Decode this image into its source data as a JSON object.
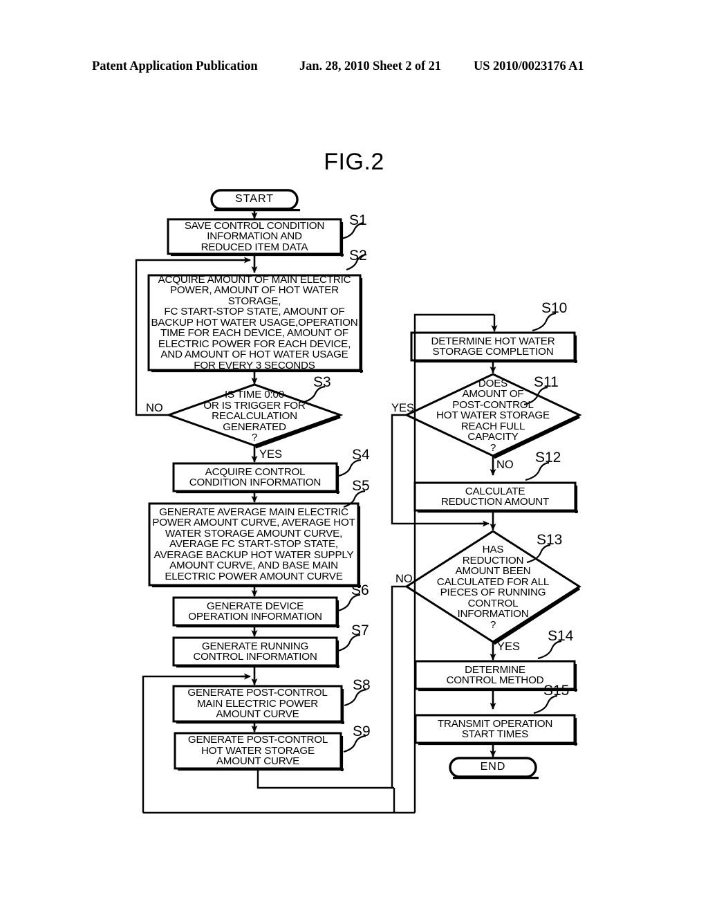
{
  "header": {
    "left": "Patent Application Publication",
    "middle": "Jan. 28, 2010  Sheet 2 of 21",
    "right": "US 2010/0023176 A1"
  },
  "figure": {
    "title": "FIG.2"
  },
  "flowchart": {
    "nodes": [
      {
        "id": "start",
        "shape": "terminator",
        "text": "START"
      },
      {
        "id": "s1",
        "shape": "process",
        "text": "SAVE CONTROL CONDITION\nINFORMATION AND\nREDUCED ITEM DATA"
      },
      {
        "id": "s2",
        "shape": "process",
        "text": "ACQUIRE AMOUNT OF MAIN ELECTRIC\nPOWER, AMOUNT OF HOT WATER STORAGE,\nFC START-STOP STATE, AMOUNT OF\nBACKUP HOT WATER USAGE,OPERATION\nTIME FOR EACH DEVICE, AMOUNT OF\nELECTRIC POWER FOR EACH DEVICE,\nAND AMOUNT OF HOT WATER USAGE\nFOR EVERY 3 SECONDS"
      },
      {
        "id": "s3",
        "shape": "decision",
        "text": "IS TIME 0:00\nOR IS TRIGGER FOR\nRECALCULATION\nGENERATED\n?"
      },
      {
        "id": "s4",
        "shape": "process",
        "text": "ACQUIRE CONTROL\nCONDITION INFORMATION"
      },
      {
        "id": "s5",
        "shape": "process",
        "text": "GENERATE AVERAGE MAIN ELECTRIC\nPOWER AMOUNT CURVE, AVERAGE HOT\nWATER STORAGE AMOUNT CURVE,\nAVERAGE FC START-STOP STATE,\nAVERAGE BACKUP HOT WATER SUPPLY\nAMOUNT CURVE, AND BASE MAIN\nELECTRIC POWER AMOUNT CURVE"
      },
      {
        "id": "s6",
        "shape": "process",
        "text": "GENERATE DEVICE\nOPERATION INFORMATION"
      },
      {
        "id": "s7",
        "shape": "process",
        "text": "GENERATE RUNNING\nCONTROL INFORMATION"
      },
      {
        "id": "s8",
        "shape": "process",
        "text": "GENERATE POST-CONTROL\nMAIN ELECTRIC POWER\nAMOUNT CURVE"
      },
      {
        "id": "s9",
        "shape": "process",
        "text": "GENERATE POST-CONTROL\nHOT WATER STORAGE\nAMOUNT CURVE"
      },
      {
        "id": "s10",
        "shape": "process",
        "text": "DETERMINE HOT WATER\nSTORAGE COMPLETION"
      },
      {
        "id": "s11",
        "shape": "decision",
        "text": "DOES\nAMOUNT OF\nPOST-CONTROL\nHOT WATER STORAGE\nREACH FULL\nCAPACITY\n?"
      },
      {
        "id": "s12",
        "shape": "process",
        "text": "CALCULATE\nREDUCTION AMOUNT"
      },
      {
        "id": "s13",
        "shape": "decision",
        "text": "HAS\nREDUCTION\nAMOUNT BEEN\nCALCULATED FOR ALL\nPIECES OF RUNNING\nCONTROL\nINFORMATION\n?"
      },
      {
        "id": "s14",
        "shape": "process",
        "text": "DETERMINE\nCONTROL METHOD"
      },
      {
        "id": "s15",
        "shape": "process",
        "text": "TRANSMIT OPERATION\nSTART TIMES"
      },
      {
        "id": "end",
        "shape": "terminator",
        "text": "END"
      }
    ],
    "step_labels": [
      {
        "id": "l1",
        "text": "S1"
      },
      {
        "id": "l2",
        "text": "S2"
      },
      {
        "id": "l3",
        "text": "S3"
      },
      {
        "id": "l4",
        "text": "S4"
      },
      {
        "id": "l5",
        "text": "S5"
      },
      {
        "id": "l6",
        "text": "S6"
      },
      {
        "id": "l7",
        "text": "S7"
      },
      {
        "id": "l8",
        "text": "S8"
      },
      {
        "id": "l9",
        "text": "S9"
      },
      {
        "id": "l10",
        "text": "S10"
      },
      {
        "id": "l11",
        "text": "S11"
      },
      {
        "id": "l12",
        "text": "S12"
      },
      {
        "id": "l13",
        "text": "S13"
      },
      {
        "id": "l14",
        "text": "S14"
      },
      {
        "id": "l15",
        "text": "S15"
      }
    ],
    "edge_labels": [
      {
        "id": "e_s3_no",
        "text": "NO"
      },
      {
        "id": "e_s3_yes",
        "text": "YES"
      },
      {
        "id": "e_s11_yes",
        "text": "YES"
      },
      {
        "id": "e_s11_no",
        "text": "NO"
      },
      {
        "id": "e_s13_no",
        "text": "NO"
      },
      {
        "id": "e_s13_yes",
        "text": "YES"
      }
    ]
  },
  "colors": {
    "ink": "#000000",
    "page": "#ffffff"
  }
}
